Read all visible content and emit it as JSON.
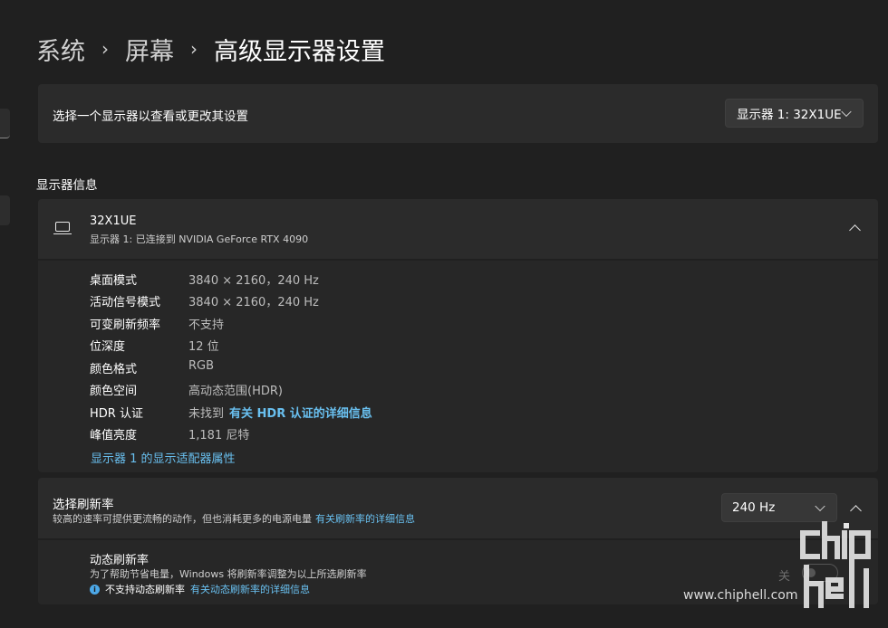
{
  "breadcrumb": [
    "系统",
    "屏幕",
    "高级显示器设置"
  ],
  "breadcrumb_separator": "›",
  "display_select": {
    "label": "选择一个显示器以查看或更改其设置",
    "value": "显示器 1: 32X1UE"
  },
  "section_title": "显示器信息",
  "monitor": {
    "name": "32X1UE",
    "subtitle": "显示器 1: 已连接到 NVIDIA GeForce RTX 4090",
    "icon": "monitor-icon"
  },
  "info_rows": [
    {
      "key": "桌面模式",
      "value": "3840 × 2160，240 Hz"
    },
    {
      "key": "活动信号模式",
      "value": "3840 × 2160，240 Hz"
    },
    {
      "key": "可变刷新频率",
      "value": "不支持"
    },
    {
      "key": "位深度",
      "value": "12 位"
    },
    {
      "key": "颜色格式",
      "value": "RGB"
    },
    {
      "key": "颜色空间",
      "value": "高动态范围(HDR)"
    },
    {
      "key": "HDR 认证",
      "value": "未找到",
      "link": "有关 HDR 认证的详细信息"
    },
    {
      "key": "峰值亮度",
      "value": "1,181 尼特"
    }
  ],
  "adapter_link": "显示器 1 的显示适配器属性",
  "refresh": {
    "title": "选择刷新率",
    "subtitle": "较高的速率可提供更流畅的动作，但也消耗更多的电源电量",
    "link": "有关刷新率的详细信息",
    "value": "240 Hz"
  },
  "dynamic_refresh": {
    "title": "动态刷新率",
    "subtitle": "为了帮助节省电量，Windows 将刷新率调整为以上所选刷新率",
    "note": "不支持动态刷新率",
    "note_link": "有关动态刷新率的详细信息",
    "toggle_label": "关",
    "toggle_on": false
  },
  "watermark": {
    "url": "www.chiphell.com",
    "logo_text": "chip hell"
  },
  "colors": {
    "background": "#202020",
    "card": "#2b2b2b",
    "card_body": "#272727",
    "link": "#69c0f0",
    "text_secondary": "#cfcfcf"
  }
}
